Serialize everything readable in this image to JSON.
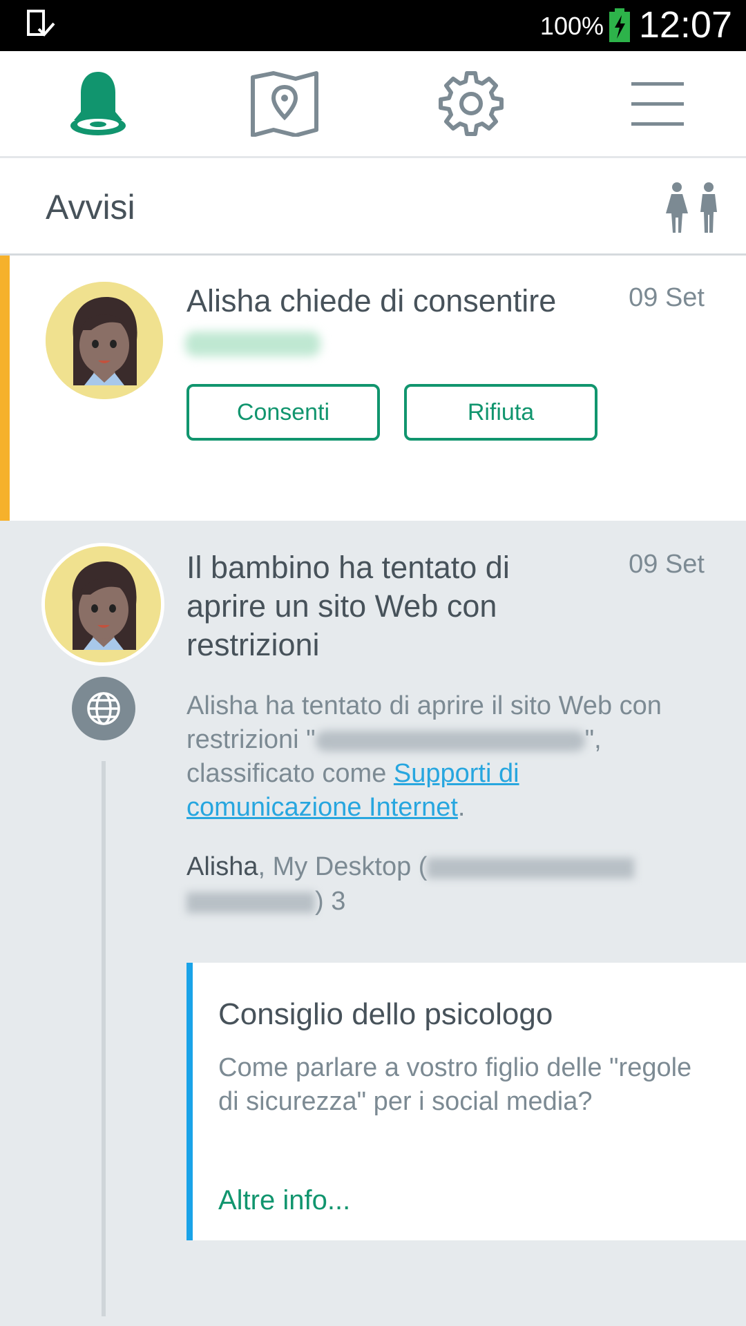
{
  "status_bar": {
    "battery_percent": "100%",
    "time": "12:07",
    "icons": [
      "device-check-icon",
      "battery-charging-icon"
    ]
  },
  "nav": {
    "tabs": [
      {
        "icon": "bell-icon",
        "active": true
      },
      {
        "icon": "map-pin-icon",
        "active": false
      },
      {
        "icon": "gear-icon",
        "active": false
      },
      {
        "icon": "menu-icon",
        "active": false
      }
    ],
    "active_color": "#11956e",
    "inactive_color": "#7c8a93"
  },
  "header": {
    "title": "Avvisi",
    "family_icon": "family-icon"
  },
  "alerts": [
    {
      "title": "Alisha chiede di consentire",
      "date": "09 Set",
      "accent_color": "#f6b12b",
      "actions": [
        "Consenti",
        "Rifiuta"
      ]
    },
    {
      "title": "Il bambino ha tentato di aprire un sito Web con restrizioni",
      "date": "09 Set",
      "icon": "globe-icon",
      "description_prefix": "Alisha ha tentato di aprire il sito Web con restrizioni \"",
      "description_mid": "\", classificato come ",
      "category_link": "Supporti di comunicazione Internet",
      "description_suffix": ".",
      "device_user": "Alisha",
      "device_label": ", My Desktop (",
      "device_suffix": ") 3",
      "tip": {
        "title": "Consiglio dello psicologo",
        "body": "Come parlare a vostro figlio delle \"regole di sicurezza\" per i social media?",
        "link": "Altre info..."
      }
    }
  ]
}
